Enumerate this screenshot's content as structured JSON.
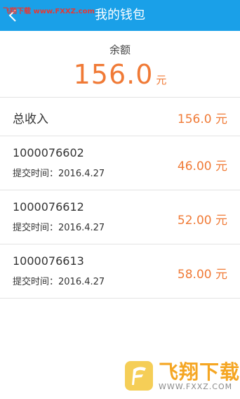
{
  "header": {
    "title": "我的钱包",
    "watermark_text": "飞翔下载 www.FXXZ.com"
  },
  "balance": {
    "label": "余额",
    "amount": "156.0",
    "unit": "元"
  },
  "total_income": {
    "label": "总收入",
    "value": "156.0  元"
  },
  "records": [
    {
      "order_no": "1000076602",
      "submitted": "提交时间：2016.4.27",
      "amount": "46.00 元"
    },
    {
      "order_no": "1000076612",
      "submitted": "提交时间：2016.4.27",
      "amount": "52.00 元"
    },
    {
      "order_no": "1000076613",
      "submitted": "提交时间：2016.4.27",
      "amount": "58.00 元"
    }
  ],
  "watermark": {
    "name": "飞翔下载",
    "url": "WWW.FXXZ.COM"
  },
  "colors": {
    "header_bg": "#1aa0e8",
    "accent_orange": "#f07a36",
    "divider": "#e3e3e3"
  }
}
